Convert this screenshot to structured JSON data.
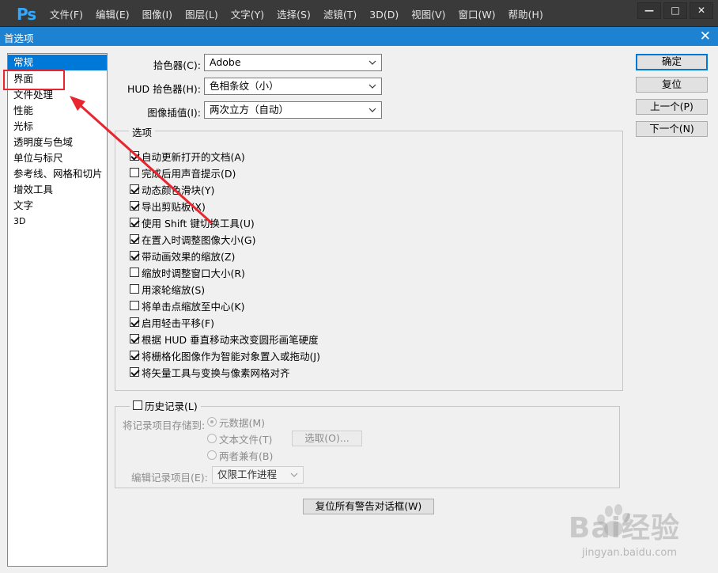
{
  "app": {
    "logo": "Ps",
    "menu": [
      "文件(F)",
      "编辑(E)",
      "图像(I)",
      "图层(L)",
      "文字(Y)",
      "选择(S)",
      "滤镜(T)",
      "3D(D)",
      "视图(V)",
      "窗口(W)",
      "帮助(H)"
    ],
    "window_controls": [
      "—",
      "□",
      "✕"
    ]
  },
  "dialog": {
    "title": "首选项",
    "close": "✕"
  },
  "categories": [
    "常规",
    "界面",
    "文件处理",
    "性能",
    "光标",
    "透明度与色域",
    "单位与标尺",
    "参考线、网格和切片",
    "增效工具",
    "文字",
    "3D"
  ],
  "selected_category": "常规",
  "fields": {
    "color_picker": {
      "label": "拾色器(C):",
      "value": "Adobe"
    },
    "hud_color_picker": {
      "label": "HUD 拾色器(H):",
      "value": "色相条纹（小）"
    },
    "interpolation": {
      "label": "图像插值(I):",
      "value": "两次立方（自动）"
    }
  },
  "options": {
    "legend": "选项",
    "items": [
      {
        "label": "自动更新打开的文档(A)",
        "checked": true
      },
      {
        "label": "完成后用声音提示(D)",
        "checked": false
      },
      {
        "label": "动态颜色滑块(Y)",
        "checked": true
      },
      {
        "label": "导出剪贴板(X)",
        "checked": true
      },
      {
        "label": "使用 Shift 键切换工具(U)",
        "checked": true
      },
      {
        "label": "在置入时调整图像大小(G)",
        "checked": true
      },
      {
        "label": "带动画效果的缩放(Z)",
        "checked": true
      },
      {
        "label": "缩放时调整窗口大小(R)",
        "checked": false
      },
      {
        "label": "用滚轮缩放(S)",
        "checked": false
      },
      {
        "label": "将单击点缩放至中心(K)",
        "checked": false
      },
      {
        "label": "启用轻击平移(F)",
        "checked": true
      },
      {
        "label": "根据 HUD 垂直移动来改变圆形画笔硬度",
        "checked": true
      },
      {
        "label": "将栅格化图像作为智能对象置入或拖动(J)",
        "checked": true
      },
      {
        "label": "将矢量工具与变换与像素网格对齐",
        "checked": true
      }
    ]
  },
  "history": {
    "legend": "历史记录(L)",
    "checked": false,
    "save_to_label": "将记录项目存储到:",
    "radios": [
      {
        "label": "元数据(M)",
        "selected": true
      },
      {
        "label": "文本文件(T)",
        "selected": false
      },
      {
        "label": "两者兼有(B)",
        "selected": false
      }
    ],
    "choose_button": "选取(O)...",
    "edit_log_label": "编辑记录项目(E):",
    "edit_log_value": "仅限工作进程"
  },
  "reset_warnings_button": "复位所有警告对话框(W)",
  "buttons": {
    "ok": "确定",
    "reset": "复位",
    "prev": "上一个(P)",
    "next": "下一个(N)"
  },
  "watermark": {
    "brand": "Bai经验",
    "url": "jingyan.baidu.com"
  },
  "colors": {
    "title_bar": "#1e82d2",
    "selection": "#0078d7",
    "annotation": "#e8262f",
    "ps_logo": "#31a8ff"
  }
}
